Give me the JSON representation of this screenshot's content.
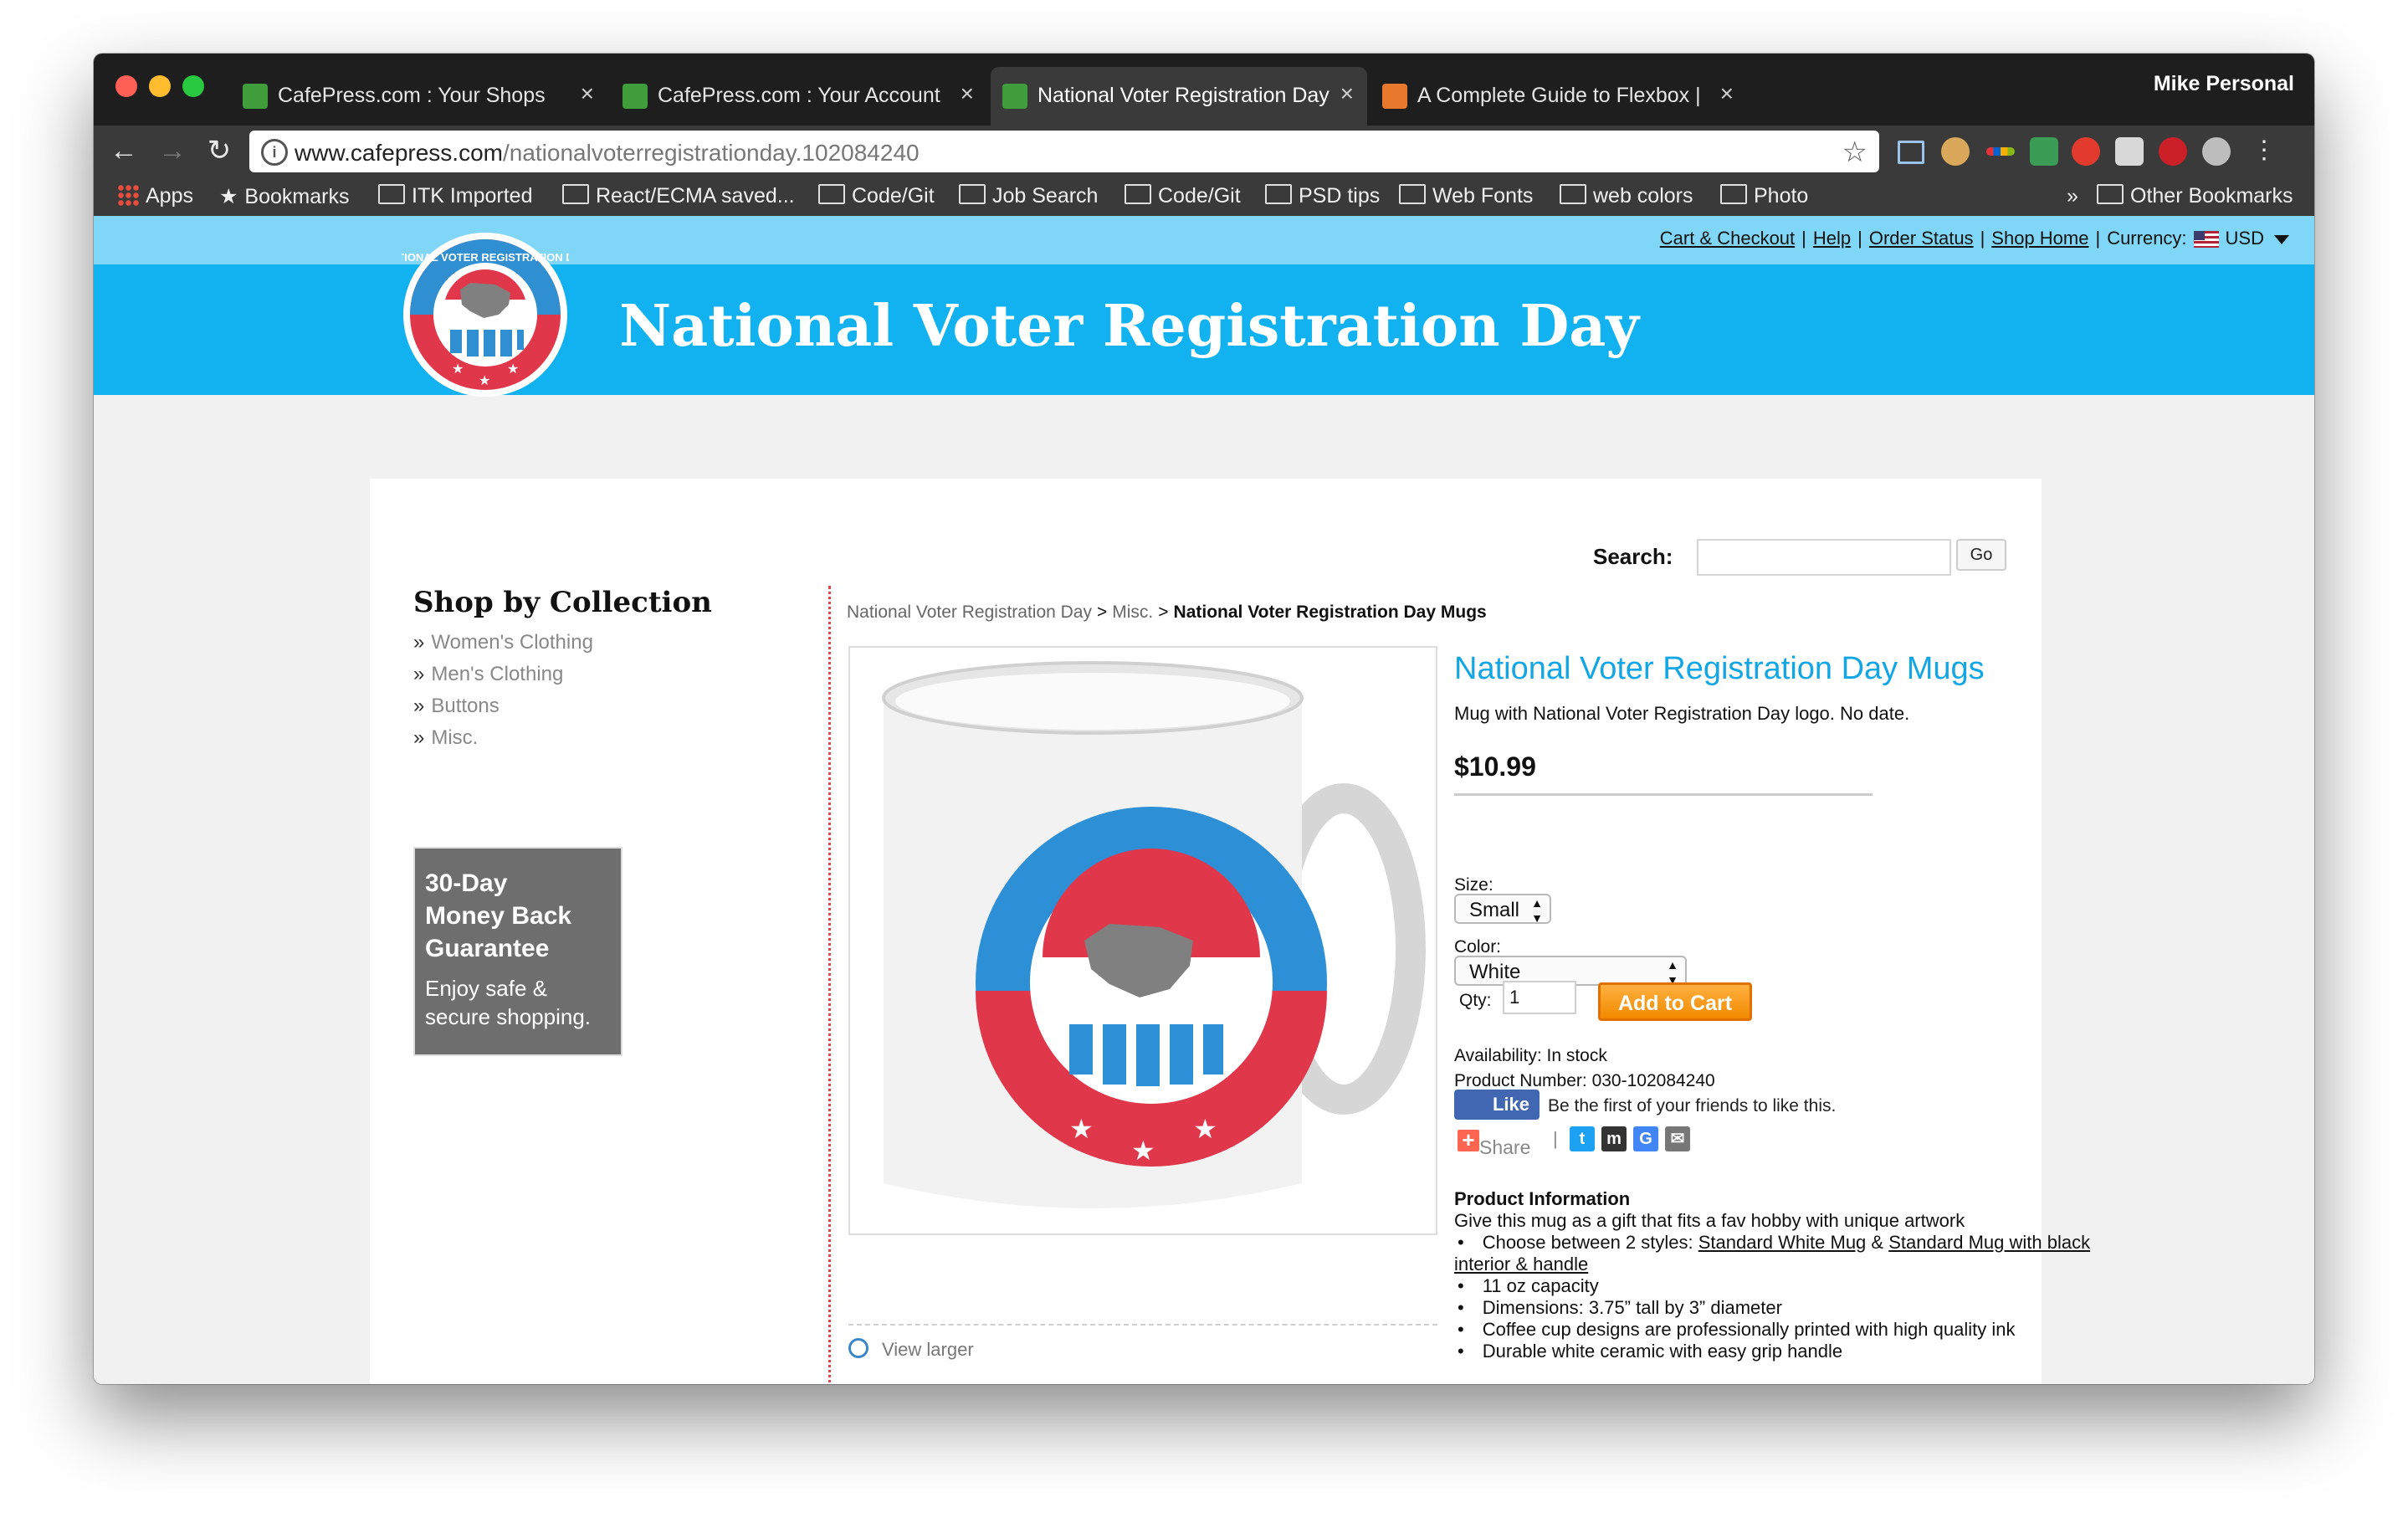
{
  "browser": {
    "profile": "Mike Personal",
    "tabs": [
      {
        "title": "CafePress.com : Your Shops",
        "active": false
      },
      {
        "title": "CafePress.com : Your Account",
        "active": false
      },
      {
        "title": "National Voter Registration Day",
        "active": true
      },
      {
        "title": "A Complete Guide to Flexbox |",
        "active": false
      }
    ],
    "url_host": "www.cafepress.com",
    "url_path": "/nationalvoterregistrationday.102084240",
    "bookmarks": [
      "Apps",
      "Bookmarks",
      "ITK Imported",
      "React/ECMA saved...",
      "Code/Git",
      "Job Search",
      "Code/Git",
      "PSD tips",
      "Web Fonts",
      "web colors",
      "Photo"
    ],
    "bookmarks_overflow": "»",
    "other_bookmarks": "Other Bookmarks"
  },
  "utility": {
    "links": [
      "Cart & Checkout",
      "Help",
      "Order Status",
      "Shop Home"
    ],
    "currency_label": "Currency:",
    "currency": "USD"
  },
  "banner": {
    "title": "National Voter Registration Day",
    "logo_text": "NATIONAL VOTER REGISTRATION DAY"
  },
  "search": {
    "label": "Search:",
    "value": "",
    "button": "Go"
  },
  "sidebar": {
    "title": "Shop by Collection",
    "items": [
      "Women's Clothing",
      "Men's Clothing",
      "Buttons",
      "Misc."
    ],
    "guarantee": {
      "line1": "30-Day",
      "line2": "Money Back",
      "line3": "Guarantee",
      "sub1": "Enjoy safe &",
      "sub2": "secure shopping."
    }
  },
  "breadcrumb": {
    "crumb1": "National Voter Registration Day",
    "crumb2": "Misc.",
    "current": "National Voter Registration Day Mugs"
  },
  "product": {
    "title": "National Voter Registration Day Mugs",
    "description": "Mug with National Voter Registration Day logo. No date.",
    "price": "$10.99",
    "size_label": "Size:",
    "size_value": "Small",
    "color_label": "Color:",
    "color_value": "White",
    "qty_label": "Qty:",
    "qty_value": "1",
    "add_to_cart": "Add to Cart",
    "availability": "Availability: In stock",
    "product_number": "Product Number: 030-102084240",
    "fb_like": "Like",
    "fb_text": "Be the first of your friends to like this.",
    "share": "Share",
    "view_larger": "View larger",
    "info_title": "Product Information",
    "info_intro": "Give this mug as a gift that fits a fav hobby with unique artwork",
    "info_styles_prefix": "Choose between 2 styles: ",
    "info_style1": "Standard White Mug",
    "info_styles_amp": " & ",
    "info_style2": "Standard Mug with black interior & handle",
    "info_capacity": "11 oz capacity",
    "info_dimensions": "Dimensions: 3.75” tall by 3” diameter",
    "info_print": "Coffee cup designs are professionally printed with high quality ink",
    "info_durable": "Durable white ceramic with easy grip handle"
  },
  "colors": {
    "banner": "#12b1f0",
    "utility_bar": "#7fd6f6",
    "title_blue": "#12a6e4",
    "cart_orange": "#f18a00"
  }
}
